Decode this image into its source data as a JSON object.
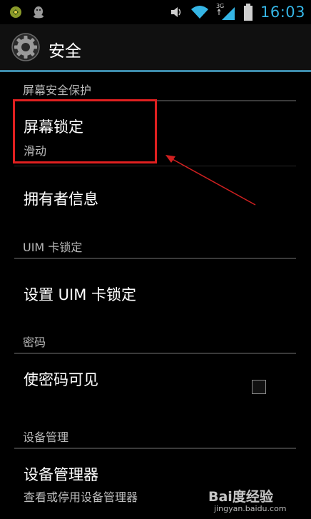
{
  "status_bar": {
    "clock": "16:03",
    "network_type": "3G",
    "left_icons": [
      "sync-app-icon",
      "qq-icon"
    ],
    "right_icons": [
      "volume-icon",
      "wifi-icon",
      "signal-icon",
      "battery-icon"
    ],
    "accent_color": "#35b5e5"
  },
  "action_bar": {
    "title": "安全",
    "icon": "settings-gear-icon",
    "underline_color": "#3d8bab"
  },
  "sections": [
    {
      "header": "屏幕安全保护",
      "items": [
        {
          "title": "屏幕锁定",
          "summary": "滑动"
        },
        {
          "title": "拥有者信息"
        }
      ]
    },
    {
      "header": "UIM 卡锁定",
      "items": [
        {
          "title": "设置 UIM 卡锁定"
        }
      ]
    },
    {
      "header": "密码",
      "items": [
        {
          "title": "使密码可见",
          "checked": false
        }
      ]
    },
    {
      "header": "设备管理",
      "items": [
        {
          "title": "设备管理器",
          "summary": "查看或停用设备管理器"
        }
      ]
    }
  ],
  "annotation": {
    "color": "#e02020"
  },
  "watermark": {
    "line1": "Bai度经验",
    "line2": "jingyan.baidu.com"
  }
}
